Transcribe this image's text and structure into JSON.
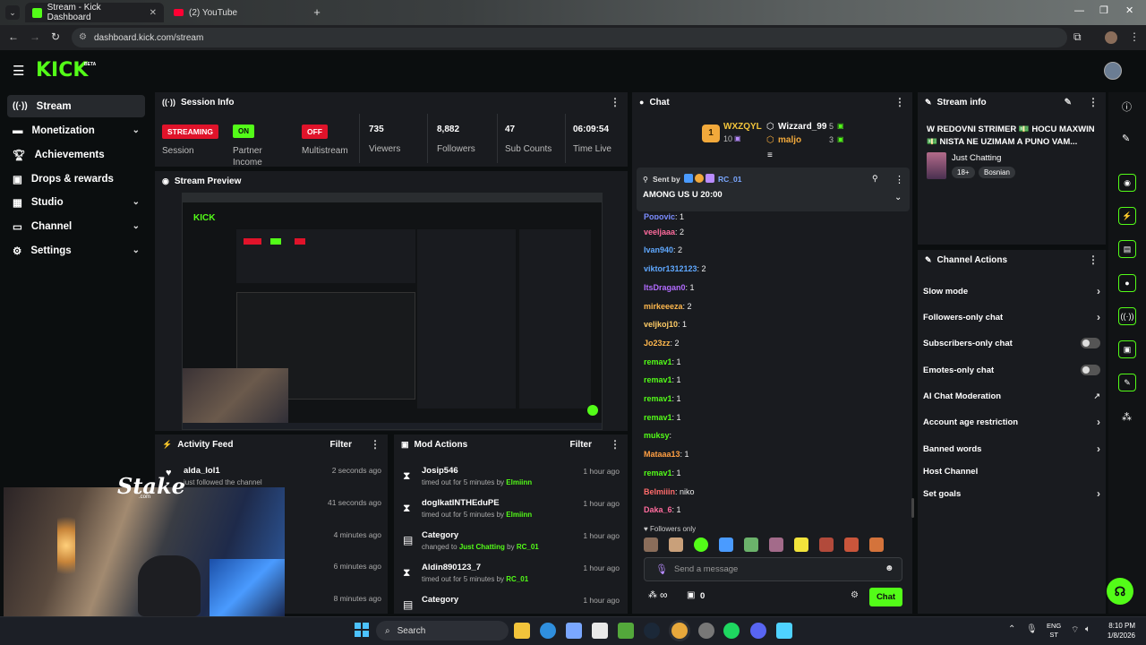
{
  "browser": {
    "tabs": [
      {
        "title": "Stream - Kick Dashboard",
        "active": true
      },
      {
        "title": "(2) YouTube",
        "active": false
      }
    ],
    "url": "dashboard.kick.com/stream"
  },
  "brand": {
    "logo": "KICK",
    "beta": "BETA",
    "accent": "#53fc18"
  },
  "sidebar": {
    "items": [
      {
        "label": "Stream",
        "icon": "stream-icon",
        "active": true
      },
      {
        "label": "Monetization",
        "icon": "dollar-icon",
        "chevron": true
      },
      {
        "label": "Achievements",
        "icon": "trophy-icon"
      },
      {
        "label": "Drops & rewards",
        "icon": "gift-icon"
      },
      {
        "label": "Studio",
        "icon": "studio-icon",
        "chevron": true
      },
      {
        "label": "Channel",
        "icon": "channel-icon",
        "chevron": true
      },
      {
        "label": "Settings",
        "icon": "gear-icon",
        "chevron": true
      }
    ]
  },
  "session": {
    "title": "Session Info",
    "session_badge": "STREAMING",
    "session_label": "Session",
    "partner_badge": "ON",
    "partner_label": "Partner Income",
    "multistream_badge": "OFF",
    "multistream_label": "Multistream",
    "viewers": "735",
    "viewers_label": "Viewers",
    "followers": "8,882",
    "followers_label": "Followers",
    "subs": "47",
    "subs_label": "Sub Counts",
    "time": "06:09:54",
    "time_label": "Time Live"
  },
  "preview": {
    "title": "Stream Preview"
  },
  "activity": {
    "title": "Activity Feed",
    "filter": "Filter",
    "rows": [
      {
        "name": "alda_lol1",
        "action": "just followed the channel",
        "time": "2 seconds ago"
      },
      {
        "time": "41 seconds ago"
      },
      {
        "time": "4 minutes ago"
      },
      {
        "time": "6 minutes ago"
      },
      {
        "time": "8 minutes ago"
      }
    ]
  },
  "mod": {
    "title": "Mod Actions",
    "filter": "Filter",
    "rows": [
      {
        "name": "Josip546",
        "pre": "timed out for 5 minutes by ",
        "by": "Elmiinn",
        "time": "1 hour ago",
        "icon": "hourglass-icon"
      },
      {
        "name": "doglkatINTHEduPE",
        "pre": "timed out for 5 minutes by ",
        "by": "Elmiinn",
        "time": "1 hour ago",
        "icon": "hourglass-icon"
      },
      {
        "name": "Category",
        "pre": "changed to ",
        "cat": "Just Chatting",
        "mid": " by ",
        "by": "RC_01",
        "time": "1 hour ago",
        "icon": "category-icon"
      },
      {
        "name": "Aldin890123_7",
        "pre": "timed out for 5 minutes by ",
        "by": "RC_01",
        "time": "1 hour ago",
        "icon": "hourglass-icon"
      },
      {
        "name": "Category",
        "time": "1 hour ago",
        "icon": "category-icon"
      }
    ]
  },
  "chat": {
    "title": "Chat",
    "top1": {
      "name": "WXZQYL",
      "count": "10",
      "rank": "1"
    },
    "top2": {
      "name": "Wizzard_99",
      "count": "5"
    },
    "top3": {
      "name": "maljo",
      "count": "3"
    },
    "pinned": {
      "sent_by": "Sent by",
      "user": "RC_01",
      "message": "AMONG US U 20:00"
    },
    "messages": [
      {
        "user": "Popovic",
        "text": ": 1",
        "color": "#7b8cff"
      },
      {
        "user": "veeljaaa",
        "text": ": 2",
        "color": "#ff6b9d"
      },
      {
        "user": "Ivan940",
        "text": ": 2",
        "color": "#5fa8ff"
      },
      {
        "user": "viktor1312123",
        "text": ": 2",
        "color": "#5fa8ff"
      },
      {
        "user": "ItsDragan0",
        "text": ": 1",
        "color": "#b26bff"
      },
      {
        "user": "mirkeeeza",
        "text": ": 2",
        "color": "#ffb84d"
      },
      {
        "user": "veljkoj10",
        "text": ": 1",
        "color": "#ffcc66"
      },
      {
        "user": "Jo23zz",
        "text": ": 2",
        "color": "#ffb84d"
      },
      {
        "user": "remav1",
        "text": ": 1",
        "color": "#53fc18"
      },
      {
        "user": "remav1",
        "text": ": 1",
        "color": "#53fc18"
      },
      {
        "user": "remav1",
        "text": ": 1",
        "color": "#53fc18"
      },
      {
        "user": "remav1",
        "text": ": 1",
        "color": "#53fc18"
      },
      {
        "user": "muksy",
        "text": ":",
        "color": "#53fc18"
      },
      {
        "user": "Mataaa13",
        "text": ": 1",
        "color": "#ff9f43"
      },
      {
        "user": "remav1",
        "text": ": 1",
        "color": "#53fc18"
      },
      {
        "user": "Belmiiin",
        "text": ": niko",
        "color": "#ff6b6b"
      },
      {
        "user": "Daka_6",
        "text": ": 1",
        "color": "#ff6b9d"
      }
    ],
    "followers_only": "Followers only",
    "placeholder": "Send a message",
    "infinity": "∞",
    "gift_count": "0",
    "send_label": "Chat"
  },
  "stream_info": {
    "title": "Stream info",
    "stream_title": "W REDOVNI STRIMER 💵 HOCU MAXWIN 💵 NISTA NE UZIMAM A PUNO VAM...",
    "category": "Just Chatting",
    "tags": [
      "18+",
      "Bosnian"
    ]
  },
  "channel_actions": {
    "title": "Channel Actions",
    "items": [
      {
        "label": "Slow mode",
        "control": "chevron"
      },
      {
        "label": "Followers-only chat",
        "control": "chevron"
      },
      {
        "label": "Subscribers-only chat",
        "control": "toggle"
      },
      {
        "label": "Emotes-only chat",
        "control": "toggle"
      },
      {
        "label": "AI Chat Moderation",
        "control": "external"
      },
      {
        "label": "Account age restriction",
        "control": "chevron"
      },
      {
        "label": "Banned words",
        "control": "chevron"
      },
      {
        "label": "Host Channel",
        "control": "none"
      },
      {
        "label": "Set goals",
        "control": "chevron"
      }
    ]
  },
  "overlay": {
    "stake": "Stake",
    "stake_sub": ".com"
  },
  "taskbar": {
    "search": "Search",
    "lang1": "ENG",
    "lang2": "ST",
    "time": "8:10 PM",
    "date": "1/8/2026"
  }
}
